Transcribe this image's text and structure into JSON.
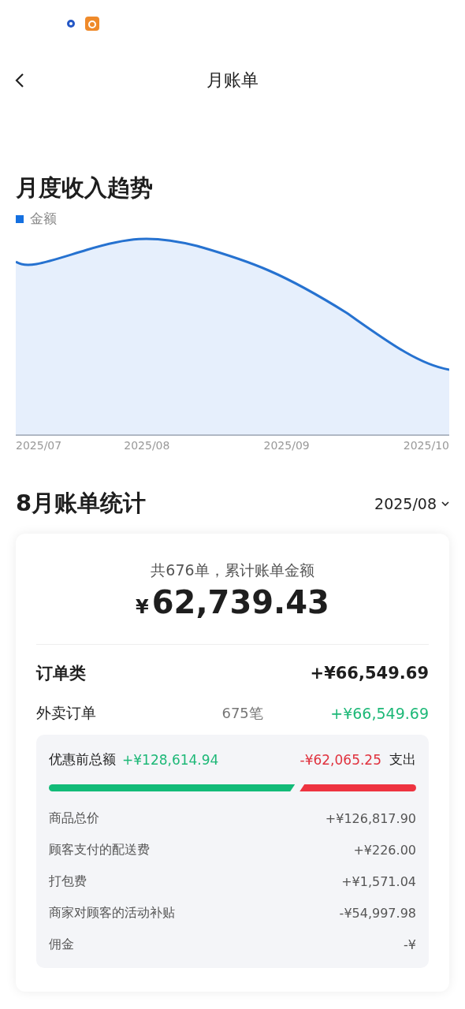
{
  "header": {
    "title": "月账单"
  },
  "trend": {
    "title": "月度收入趋势",
    "legend": "金额",
    "x_labels": [
      "2025/07",
      "2025/08",
      "2025/09",
      "2025/10"
    ]
  },
  "stats": {
    "title": "8月账单统计",
    "period": "2025/08"
  },
  "summary": {
    "caption": "共676单，累计账单金额",
    "currency": "¥",
    "total": "62,739.43"
  },
  "category": {
    "name": "订单类",
    "amount": "+¥66,549.69"
  },
  "order_type": {
    "name": "外卖订单",
    "count": "675笔",
    "amount": "+¥66,549.69"
  },
  "breakdown": {
    "income_label": "优惠前总额",
    "income": "+¥128,614.94",
    "expense": "-¥62,065.25",
    "expense_label": "支出",
    "level": 0.67,
    "rows": [
      {
        "label": "商品总价",
        "value": "+¥126,817.90"
      },
      {
        "label": "顾客支付的配送费",
        "value": "+¥226.00"
      },
      {
        "label": "打包费",
        "value": "+¥1,571.04"
      },
      {
        "label": "商家对顾客的活动补贴",
        "value": "-¥54,997.98"
      },
      {
        "label": "佣金",
        "value": "-¥"
      }
    ]
  }
}
